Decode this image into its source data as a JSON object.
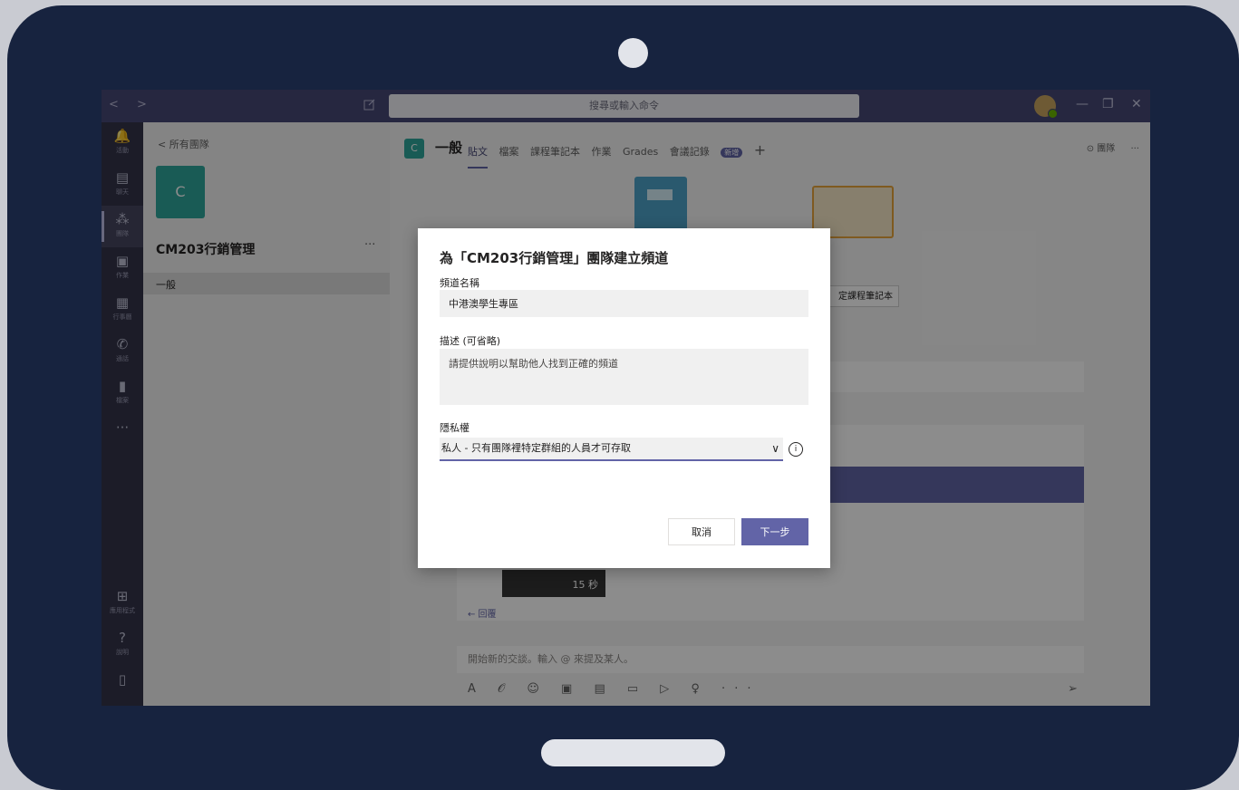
{
  "titlebar": {
    "search_placeholder": "搜尋或輸入命令",
    "nav_arrows": "< >",
    "minimize": "—",
    "restore": "❐",
    "close": "✕"
  },
  "rail": {
    "items": [
      {
        "icon": "bell-icon",
        "glyph": "🔔",
        "label": "活動"
      },
      {
        "icon": "chat-icon",
        "glyph": "▤",
        "label": "聊天"
      },
      {
        "icon": "teams-icon",
        "glyph": "⁂",
        "label": "團隊"
      },
      {
        "icon": "assignments-icon",
        "glyph": "▣",
        "label": "作業"
      },
      {
        "icon": "calendar-icon",
        "glyph": "▦",
        "label": "行事曆"
      },
      {
        "icon": "calls-icon",
        "glyph": "✆",
        "label": "通話"
      },
      {
        "icon": "files-icon",
        "glyph": "▮",
        "label": "檔案"
      },
      {
        "icon": "more-icon",
        "glyph": "···",
        "label": ""
      }
    ],
    "bottom": [
      {
        "icon": "apps-icon",
        "glyph": "⊞",
        "label": "應用程式"
      },
      {
        "icon": "help-icon",
        "glyph": "?",
        "label": "說明"
      },
      {
        "icon": "device-icon",
        "glyph": "▯",
        "label": ""
      }
    ]
  },
  "team_panel": {
    "back_label": "< 所有團隊",
    "avatar_letter": "C",
    "team_name": "CM203行銷管理",
    "more": "···",
    "channel": "一般"
  },
  "main": {
    "channel_letter": "C",
    "channel_title": "一般",
    "tabs": [
      "貼文",
      "檔案",
      "課程筆記本",
      "作業",
      "Grades",
      "會議記錄"
    ],
    "badge": "新增",
    "add_tab": "+",
    "header_right": "⊙ 團隊",
    "header_more": "···",
    "bg_button": "定課程筆記本",
    "video_duration": "15 秒",
    "reply": "← 回覆",
    "compose_placeholder": "開始新的交談。輸入 @ 來提及某人。",
    "compose_tools": "A 𝒪 ☺ ▣ ▤ ▭ ▷ ♀ ···",
    "send": "➢"
  },
  "dialog": {
    "title": "為「CM203行銷管理」團隊建立頻道",
    "name_label": "頻道名稱",
    "name_value": "中港澳學生專區",
    "desc_label": "描述 (可省略)",
    "desc_placeholder": "請提供說明以幫助他人找到正確的頻道",
    "privacy_label": "隱私權",
    "privacy_value": "私人 - 只有團隊裡特定群組的人員才可存取",
    "chevron": "∨",
    "info": "i",
    "cancel_label": "取消",
    "next_label": "下一步"
  },
  "colors": {
    "accent": "#6264a7",
    "titlebar": "#464775",
    "rail": "#33344a",
    "team_tile": "#2ea79b",
    "device_frame": "#17233f"
  }
}
